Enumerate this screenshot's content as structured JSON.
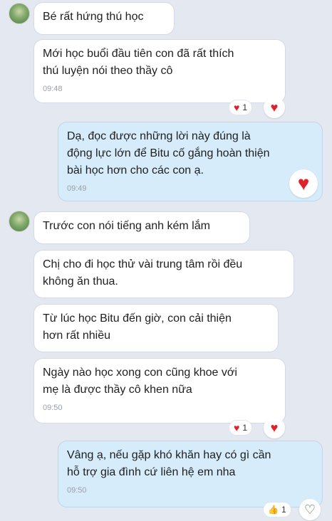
{
  "colors": {
    "background": "#e4e8f1",
    "incoming_bubble": "#ffffff",
    "outgoing_bubble": "#d6ecfb",
    "heart": "#e0202a"
  },
  "messages": [
    {
      "text": "Bé rất hứng thú học"
    },
    {
      "text": "Mới học buổi đầu tiên con đã rất thích\nthú luyện nói theo thầy cô",
      "time": "09:48",
      "reaction_count": "1"
    },
    {
      "text": "Dạ, đọc được những lời này đúng là\nđộng lực lớn để Bitu cố gắng hoàn thiện\nbài học hơn cho các con ạ.",
      "time": "09:49"
    },
    {
      "text": "Trước con nói tiếng anh kém lắm"
    },
    {
      "text": "Chị cho đi học thử vài trung tâm rồi đều\nkhông ăn thua."
    },
    {
      "text": "Từ lúc học Bitu đến giờ, con cải thiện\nhơn rất nhiều"
    },
    {
      "text": "Ngày nào học xong con cũng khoe với\nmẹ là được thầy cô khen nữa",
      "time": "09:50",
      "reaction_count": "1"
    },
    {
      "text": "Vâng ạ, nếu gặp khó khăn hay có gì cần\nhỗ trợ gia đình cứ liên hệ em nha",
      "time": "09:50",
      "reaction_count": "1"
    }
  ],
  "icons": {
    "heart": "♥",
    "thumbs_up": "👍",
    "like_outline": "♡"
  }
}
